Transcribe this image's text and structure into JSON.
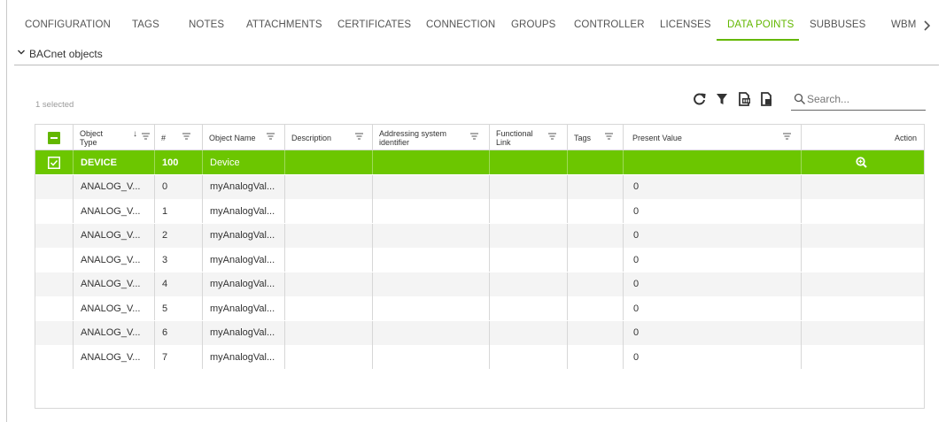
{
  "colors": {
    "accent": "#63b700",
    "selected_row": "#6cc600"
  },
  "tabs": [
    {
      "label": "CONFIGURATION"
    },
    {
      "label": "TAGS"
    },
    {
      "label": "NOTES"
    },
    {
      "label": "ATTACHMENTS"
    },
    {
      "label": "CERTIFICATES"
    },
    {
      "label": "CONNECTION"
    },
    {
      "label": "GROUPS"
    },
    {
      "label": "CONTROLLER"
    },
    {
      "label": "LICENSES"
    },
    {
      "label": "DATA POINTS",
      "active": true
    },
    {
      "label": "SUBBUSES"
    },
    {
      "label": "WBM"
    }
  ],
  "section": {
    "title": "BACnet objects"
  },
  "toolbar": {
    "selection_text": "1 selected",
    "icons": [
      "refresh-icon",
      "filter-icon",
      "export-csv-icon",
      "export-file-icon"
    ],
    "search_placeholder": "Search..."
  },
  "table": {
    "columns": [
      {
        "label": "",
        "icon": "partial-checkbox-icon"
      },
      {
        "label": "Object Type",
        "sort": "descending"
      },
      {
        "label": "#"
      },
      {
        "label": "Object Name"
      },
      {
        "label": "Description"
      },
      {
        "label": "Addressing system identifier"
      },
      {
        "label": "Functional Link"
      },
      {
        "label": "Tags"
      },
      {
        "label": "Present Value"
      },
      {
        "label": "Action"
      }
    ],
    "rows": [
      {
        "selected": true,
        "type": "DEVICE",
        "num": "100",
        "name": "Device",
        "description": "",
        "asi": "",
        "link": "",
        "tags": "",
        "value": "",
        "action": "zoom-in-icon"
      },
      {
        "selected": false,
        "type": "ANALOG_V...",
        "num": "0",
        "name": "myAnalogVal...",
        "description": "",
        "asi": "",
        "link": "",
        "tags": "",
        "value": "0",
        "action": ""
      },
      {
        "selected": false,
        "type": "ANALOG_V...",
        "num": "1",
        "name": "myAnalogVal...",
        "description": "",
        "asi": "",
        "link": "",
        "tags": "",
        "value": "0",
        "action": ""
      },
      {
        "selected": false,
        "type": "ANALOG_V...",
        "num": "2",
        "name": "myAnalogVal...",
        "description": "",
        "asi": "",
        "link": "",
        "tags": "",
        "value": "0",
        "action": ""
      },
      {
        "selected": false,
        "type": "ANALOG_V...",
        "num": "3",
        "name": "myAnalogVal...",
        "description": "",
        "asi": "",
        "link": "",
        "tags": "",
        "value": "0",
        "action": ""
      },
      {
        "selected": false,
        "type": "ANALOG_V...",
        "num": "4",
        "name": "myAnalogVal...",
        "description": "",
        "asi": "",
        "link": "",
        "tags": "",
        "value": "0",
        "action": ""
      },
      {
        "selected": false,
        "type": "ANALOG_V...",
        "num": "5",
        "name": "myAnalogVal...",
        "description": "",
        "asi": "",
        "link": "",
        "tags": "",
        "value": "0",
        "action": ""
      },
      {
        "selected": false,
        "type": "ANALOG_V...",
        "num": "6",
        "name": "myAnalogVal...",
        "description": "",
        "asi": "",
        "link": "",
        "tags": "",
        "value": "0",
        "action": ""
      },
      {
        "selected": false,
        "type": "ANALOG_V...",
        "num": "7",
        "name": "myAnalogVal...",
        "description": "",
        "asi": "",
        "link": "",
        "tags": "",
        "value": "0",
        "action": ""
      }
    ]
  }
}
